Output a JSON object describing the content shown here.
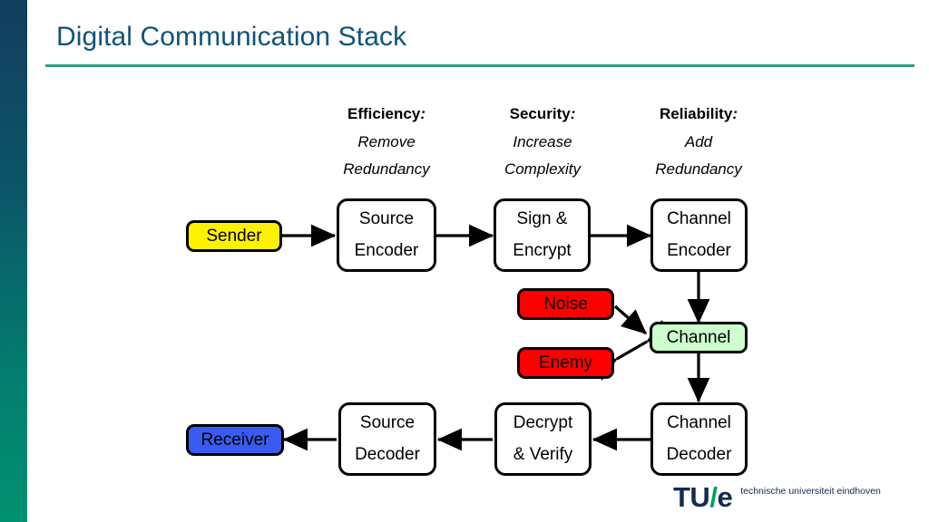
{
  "slide": {
    "title": "Digital Communication Stack",
    "title_color": "#10537A",
    "rule_color": "#2E9B86",
    "sidebar_gradient_top": "#123E5E",
    "sidebar_gradient_bottom": "#009270",
    "background": "#FFFFFF"
  },
  "column_headers": [
    {
      "label": "Efficiency",
      "colon": ":",
      "line1": "Remove",
      "line2": "Redundancy"
    },
    {
      "label": "Security",
      "colon": ":",
      "line1": "Increase",
      "line2": "Complexity"
    },
    {
      "label": "Reliability",
      "colon": ":",
      "line1": "Add",
      "line2": "Redundancy"
    }
  ],
  "nodes": {
    "sender": {
      "label": "Sender",
      "fill": "#FFF200"
    },
    "source_encoder": {
      "line1": "Source",
      "line2": "Encoder",
      "fill": "#FFFFFF"
    },
    "sign_encrypt": {
      "line1": "Sign &",
      "line2": "Encrypt",
      "fill": "#FFFFFF"
    },
    "channel_encoder": {
      "line1": "Channel",
      "line2": "Encoder",
      "fill": "#FFFFFF"
    },
    "noise": {
      "label": "Noise",
      "fill": "#FF0000"
    },
    "enemy": {
      "label": "Enemy",
      "fill": "#FF0000"
    },
    "channel": {
      "label": "Channel",
      "fill": "#CCFFCC"
    },
    "channel_decoder": {
      "line1": "Channel",
      "line2": "Decoder",
      "fill": "#FFFFFF"
    },
    "decrypt_verify": {
      "line1": "Decrypt",
      "line2": "& Verify",
      "fill": "#FFFFFF"
    },
    "source_decoder": {
      "line1": "Source",
      "line2": "Decoder",
      "fill": "#FFFFFF"
    },
    "receiver": {
      "label": "Receiver",
      "fill": "#3A5BF0"
    }
  },
  "connections": [
    {
      "name": "sender-to-source-encoder",
      "heads": 1
    },
    {
      "name": "source-encoder-to-sign-encrypt",
      "heads": 1
    },
    {
      "name": "sign-encrypt-to-channel-encoder",
      "heads": 1
    },
    {
      "name": "channel-encoder-to-channel",
      "heads": 1
    },
    {
      "name": "noise-to-channel",
      "heads": 1
    },
    {
      "name": "enemy-channel-bidirectional",
      "heads": 2
    },
    {
      "name": "channel-to-channel-decoder",
      "heads": 1
    },
    {
      "name": "channel-decoder-to-decrypt-verify",
      "heads": 1
    },
    {
      "name": "decrypt-verify-to-source-decoder",
      "heads": 1
    },
    {
      "name": "source-decoder-to-receiver",
      "heads": 1
    }
  ],
  "logo": {
    "tu": "TU",
    "slash": "/",
    "e": "e",
    "tagline": "technische universiteit eindhoven",
    "navy": "#122B54",
    "green": "#00A05A"
  }
}
